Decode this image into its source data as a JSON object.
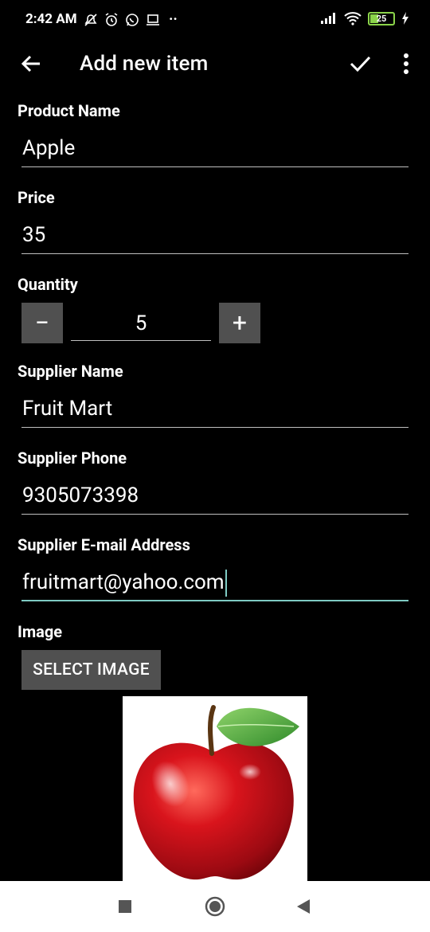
{
  "status": {
    "time": "2:42 AM",
    "battery": "25",
    "dots": "··"
  },
  "toolbar": {
    "title": "Add new item"
  },
  "form": {
    "product_name_label": "Product Name",
    "product_name_value": "Apple",
    "price_label": "Price",
    "price_value": "35",
    "quantity_label": "Quantity",
    "quantity_value": "5",
    "quantity_minus": "−",
    "quantity_plus": "+",
    "supplier_name_label": "Supplier Name",
    "supplier_name_value": "Fruit Mart",
    "supplier_phone_label": "Supplier Phone",
    "supplier_phone_value": "9305073398",
    "supplier_email_label": "Supplier E-mail Address",
    "supplier_email_value": "fruitmart@yahoo.com",
    "image_label": "Image",
    "select_image_button": "SELECT IMAGE"
  },
  "icons": {
    "back": "arrow-back-icon",
    "save": "check-icon",
    "more": "more-vert-icon",
    "nav_recents": "square-icon",
    "nav_home": "circle-icon",
    "nav_back": "triangle-back-icon"
  },
  "colors": {
    "background": "#000000",
    "accent": "#7fcbc4",
    "button_gray": "#505050",
    "battery_green": "#8bd44a"
  }
}
